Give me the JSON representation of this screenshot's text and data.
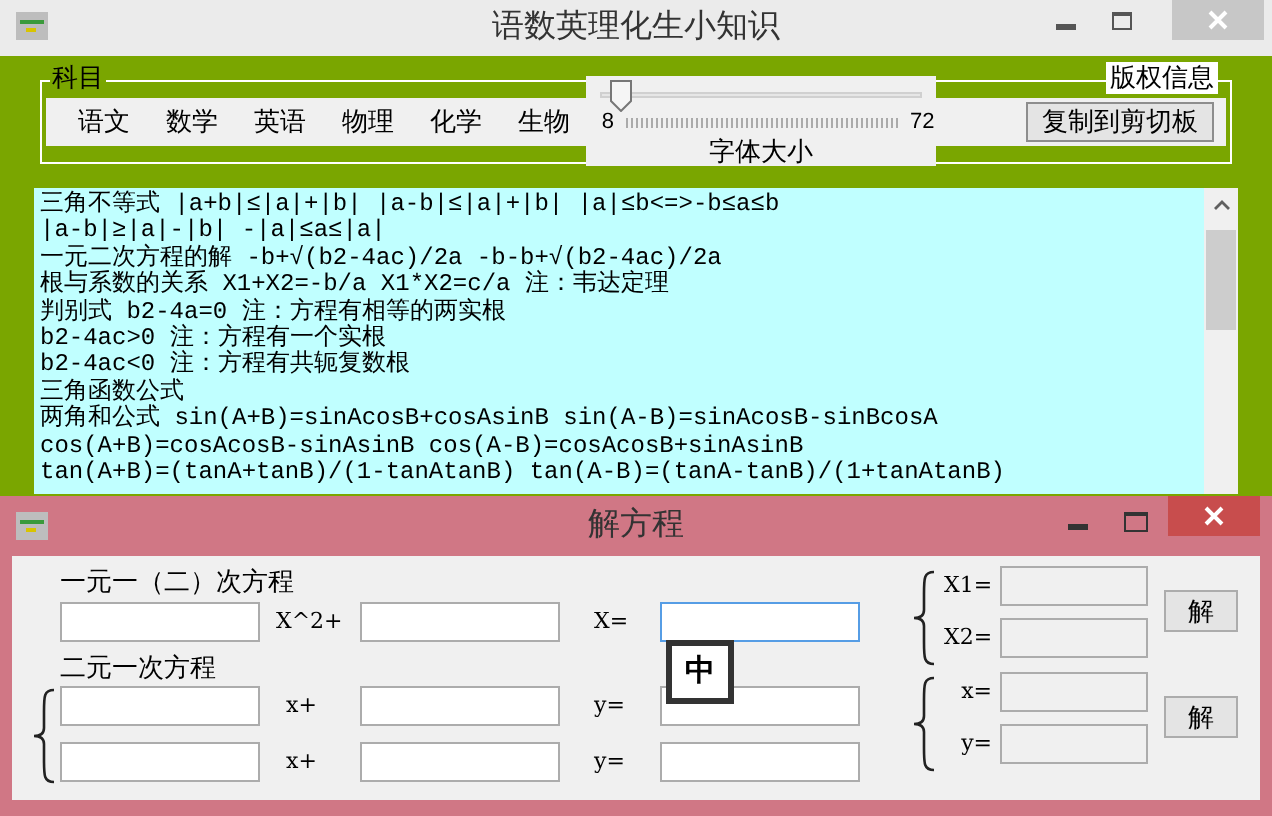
{
  "main_window": {
    "title": "语数英理化生小知识",
    "subject_group": {
      "label": "科目",
      "subjects": [
        {
          "label": "语文"
        },
        {
          "label": "数学"
        },
        {
          "label": "英语"
        },
        {
          "label": "物理"
        },
        {
          "label": "化学"
        },
        {
          "label": "生物"
        }
      ]
    },
    "font_size": {
      "min": "8",
      "max": "72",
      "label": "字体大小",
      "level": 0.03
    },
    "copyright_label": "版权信息",
    "copy_button": "复制到剪切板",
    "content_lines": [
      "三角不等式 |a+b|≤|a|+|b| |a-b|≤|a|+|b| |a|≤b<=>-b≤a≤b",
      "|a-b|≥|a|-|b| -|a|≤a≤|a|",
      "一元二次方程的解 -b+√(b2-4ac)/2a -b-b+√(b2-4ac)/2a",
      "根与系数的关系 X1+X2=-b/a X1*X2=c/a 注：韦达定理",
      "判别式 b2-4a=0 注：方程有相等的两实根",
      "b2-4ac>0 注：方程有一个实根",
      "b2-4ac<0 注：方程有共轭复数根",
      "三角函数公式",
      "两角和公式 sin(A+B)=sinAcosB+cosAsinB sin(A-B)=sinAcosB-sinBcosA",
      "cos(A+B)=cosAcosB-sinAsinB cos(A-B)=cosAcosB+sinAsinB",
      "tan(A+B)=(tanA+tanB)/(1-tanAtanB) tan(A-B)=(tanA-tanB)/(1+tanAtanB)"
    ]
  },
  "dialog": {
    "title": "解方程",
    "quadratic": {
      "label": "一元一（二）次方程",
      "term_labels": [
        "X^2+",
        "X="
      ],
      "fields": [
        {
          "focused": false
        },
        {
          "focused": false
        },
        {
          "focused": true
        }
      ]
    },
    "linear": {
      "label": "二元一次方程",
      "rows": [
        {
          "term_labels": [
            "x+",
            "y="
          ]
        },
        {
          "term_labels": [
            "x+",
            "y="
          ]
        }
      ]
    },
    "quadratic_results": {
      "labels": [
        "X1=",
        "X2="
      ],
      "button": "解"
    },
    "linear_results": {
      "labels": [
        "x=",
        "y="
      ],
      "button": "解"
    },
    "ime_indicator": "中"
  }
}
